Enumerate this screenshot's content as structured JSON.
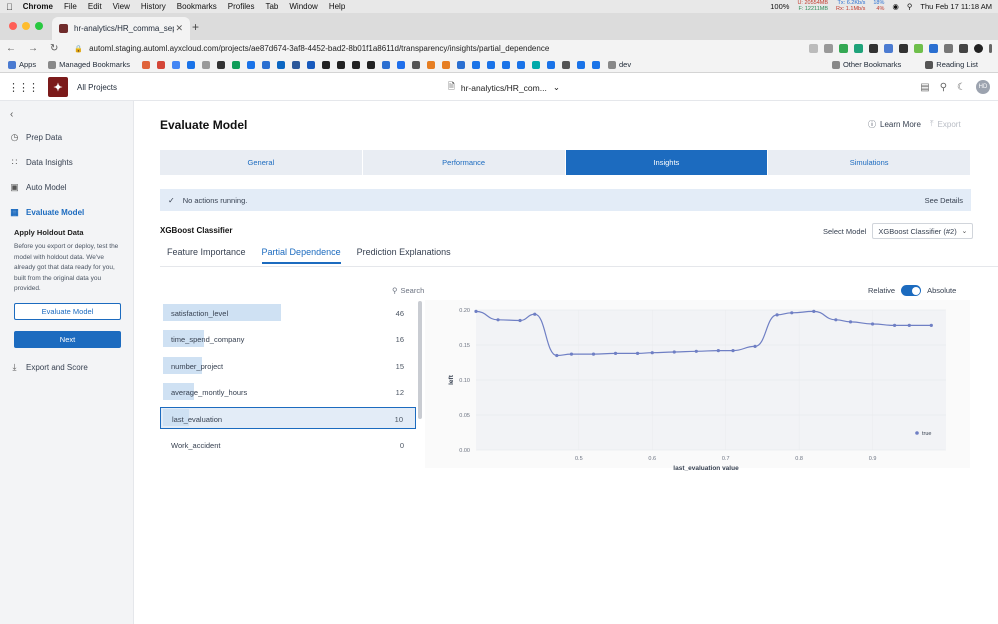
{
  "menubar": {
    "app": "Chrome",
    "items": [
      "File",
      "Edit",
      "View",
      "History",
      "Bookmarks",
      "Profiles",
      "Tab",
      "Window",
      "Help"
    ],
    "battery": "100%",
    "mem_u": "U: 20554MB",
    "mem_f": "F: 12211MB",
    "net_tx": "Tx: 6.2Kb/s",
    "net_rx": "Rx: 1.1Mb/s",
    "cpu1": "18%",
    "cpu2": "4%",
    "clock": "Thu Feb 17  11:18 AM"
  },
  "browser": {
    "tab_title": "hr-analytics/HR_comma_sep",
    "url": "automl.staging.automl.ayxcloud.com/projects/ae87d674-3af8-4452-bad2-8b01f1a8611d/transparency/insights/partial_dependence",
    "bookmarks": {
      "apps": "Apps",
      "managed": "Managed Bookmarks",
      "dev": "dev",
      "other": "Other Bookmarks",
      "reading": "Reading List"
    }
  },
  "header": {
    "all_projects": "All Projects",
    "project": "hr-analytics/HR_com...",
    "avatar": "HD"
  },
  "sidebar": {
    "items": [
      {
        "label": "Prep Data",
        "icon": "clock-icon"
      },
      {
        "label": "Data Insights",
        "icon": "insights-icon"
      },
      {
        "label": "Auto Model",
        "icon": "cube-icon"
      },
      {
        "label": "Evaluate Model",
        "icon": "chart-icon",
        "active": true
      },
      {
        "label": "Export and Score",
        "icon": "download-icon"
      }
    ],
    "holdout_title": "Apply Holdout Data",
    "holdout_text": "Before you export or deploy, test the model with holdout data. We've already got that data ready for you, built from the original data you provided.",
    "evaluate_btn": "Evaluate Model",
    "next_btn": "Next"
  },
  "main": {
    "title": "Evaluate Model",
    "learn_more": "Learn More",
    "export": "Export",
    "tabs": [
      {
        "label": "General"
      },
      {
        "label": "Performance"
      },
      {
        "label": "Insights",
        "active": true
      },
      {
        "label": "Simulations"
      }
    ],
    "status": "No actions running.",
    "see_details": "See Details",
    "classifier": "XGBoost Classifier",
    "select_model_label": "Select Model",
    "select_model_value": "XGBoost Classifier (#2)",
    "subtabs": [
      {
        "label": "Feature Importance"
      },
      {
        "label": "Partial Dependence",
        "active": true
      },
      {
        "label": "Prediction Explanations"
      }
    ],
    "search": "Search",
    "relative": "Relative",
    "absolute": "Absolute",
    "features": [
      {
        "name": "satisfaction_level",
        "count": "46",
        "frac": 1.0
      },
      {
        "name": "time_spend_company",
        "count": "16",
        "frac": 0.35
      },
      {
        "name": "number_project",
        "count": "15",
        "frac": 0.33
      },
      {
        "name": "average_montly_hours",
        "count": "12",
        "frac": 0.26
      },
      {
        "name": "last_evaluation",
        "count": "10",
        "frac": 0.22,
        "selected": true
      },
      {
        "name": "Work_accident",
        "count": "0",
        "frac": 0.0
      }
    ]
  },
  "chart_data": {
    "type": "line",
    "xlabel": "last_evaluation value",
    "ylabel": "left",
    "xlim": [
      0.36,
      1.0
    ],
    "ylim": [
      0.0,
      0.2
    ],
    "xticks": [
      0.5,
      0.6,
      0.7,
      0.8,
      0.9
    ],
    "yticks": [
      "0.00",
      "0.05",
      "0.10",
      "0.15",
      "0.20"
    ],
    "legend_position": "right",
    "series": [
      {
        "name": "true",
        "color": "#6f7fc4",
        "x": [
          0.36,
          0.39,
          0.42,
          0.44,
          0.47,
          0.49,
          0.52,
          0.55,
          0.58,
          0.6,
          0.63,
          0.66,
          0.69,
          0.71,
          0.74,
          0.77,
          0.79,
          0.82,
          0.85,
          0.87,
          0.9,
          0.93,
          0.95,
          0.98
        ],
        "values": [
          0.198,
          0.186,
          0.185,
          0.194,
          0.135,
          0.137,
          0.137,
          0.138,
          0.138,
          0.139,
          0.14,
          0.141,
          0.142,
          0.142,
          0.148,
          0.193,
          0.196,
          0.198,
          0.186,
          0.183,
          0.18,
          0.178,
          0.178,
          0.178
        ]
      }
    ]
  }
}
